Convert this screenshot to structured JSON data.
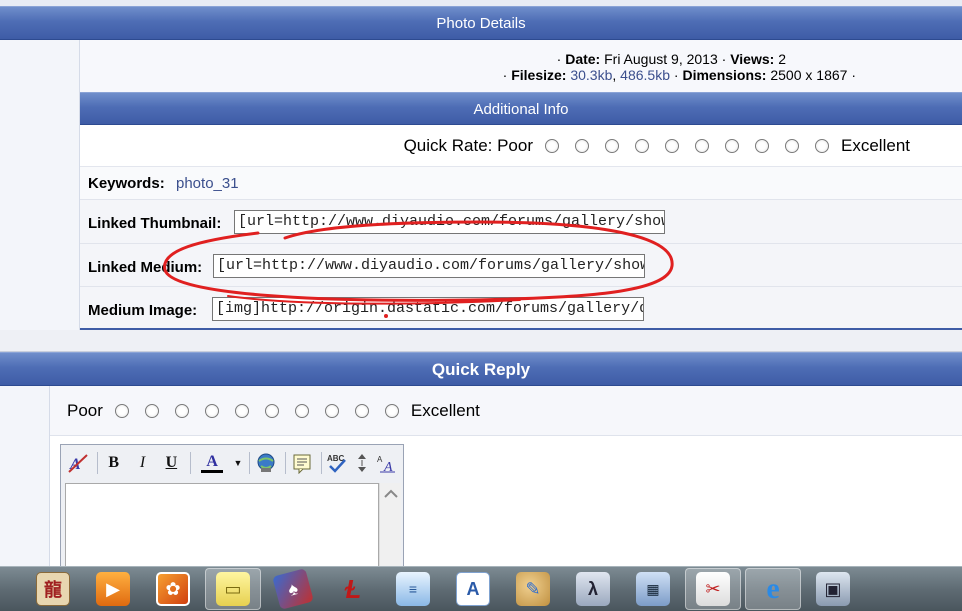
{
  "photo_details": {
    "header": "Photo Details",
    "date_label": "Date:",
    "date_value": "Fri August 9, 2013",
    "views_label": "Views:",
    "views_value": "2",
    "filesize_label": "Filesize:",
    "filesize_small": "30.3kb",
    "filesize_large": "486.5kb",
    "dimensions_label": "Dimensions:",
    "dimensions_value": "2500 x 1867"
  },
  "additional_info": {
    "header": "Additional Info",
    "quick_rate_label": "Quick Rate: Poor",
    "excellent_label": "Excellent",
    "keywords_label": "Keywords:",
    "keywords_value": "photo_31",
    "linked_thumbnail_label": "Linked Thumbnail:",
    "linked_thumbnail_value": "[url=http://www.diyaudio.com/forums/gallery/show",
    "linked_medium_label": "Linked Medium:",
    "linked_medium_value": "[url=http://www.diyaudio.com/forums/gallery/show",
    "medium_image_label": "Medium Image:",
    "medium_image_value": "[img]http://origin.dastatic.com/forums/gallery/data"
  },
  "quick_reply": {
    "header": "Quick Reply",
    "poor_label": "Poor",
    "excellent_label": "Excellent",
    "toolbar": {
      "bold": "B",
      "italic": "I",
      "underline": "U",
      "font_color": "A"
    }
  },
  "taskbar": {
    "icons": [
      "mahjong-icon",
      "media-player-icon",
      "photo-gallery-icon",
      "sticky-notes-icon",
      "solitaire-icon",
      "app-icon",
      "notepad-icon",
      "wordpad-icon",
      "paint-icon",
      "math-input-icon",
      "calculator-icon",
      "snipping-tool-icon",
      "internet-explorer-icon",
      "computer-icon"
    ]
  }
}
